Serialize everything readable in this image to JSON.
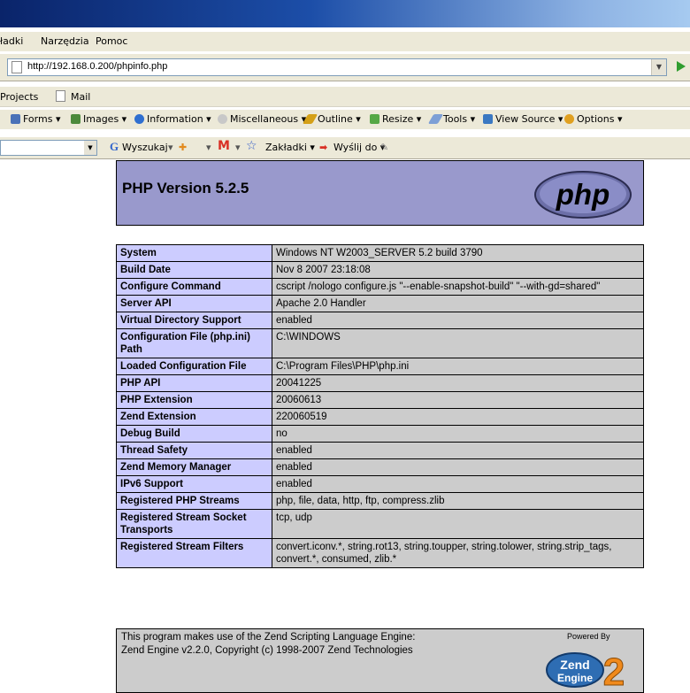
{
  "menu": {
    "items": [
      "ładki",
      "Narzędzia",
      "Pomoc"
    ]
  },
  "address": {
    "url": "http://192.168.0.200/phpinfo.php"
  },
  "links": {
    "items": [
      "Projects",
      "Mail"
    ]
  },
  "devtoolbar": {
    "items": [
      {
        "label": "Forms",
        "icon": "forms-icon",
        "color": "#4a72b8"
      },
      {
        "label": "Images",
        "icon": "images-icon",
        "color": "#4c8a3c"
      },
      {
        "label": "Information",
        "icon": "information-icon",
        "color": "#2f6fd0"
      },
      {
        "label": "Miscellaneous",
        "icon": "miscellaneous-icon",
        "color": "#b8b8b8"
      },
      {
        "label": "Outline",
        "icon": "outline-icon",
        "color": "#d4a017"
      },
      {
        "label": "Resize",
        "icon": "resize-icon",
        "color": "#55a845"
      },
      {
        "label": "Tools",
        "icon": "tools-icon",
        "color": "#7d9fd6"
      },
      {
        "label": "View Source",
        "icon": "view-source-icon",
        "color": "#3a78c2"
      },
      {
        "label": "Options",
        "icon": "options-icon",
        "color": "#e0a020"
      }
    ]
  },
  "googlebar": {
    "search_label": "Wyszukaj",
    "bookmarks_label": "Zakładki",
    "send_label": "Wyślij do"
  },
  "php": {
    "title": "PHP Version 5.2.5",
    "logo_text": "php",
    "rows": [
      {
        "key": "System",
        "value": "Windows NT W2003_SERVER 5.2 build 3790"
      },
      {
        "key": "Build Date",
        "value": "Nov 8 2007 23:18:08"
      },
      {
        "key": "Configure Command",
        "value": "cscript /nologo configure.js \"--enable-snapshot-build\" \"--with-gd=shared\""
      },
      {
        "key": "Server API",
        "value": "Apache 2.0 Handler"
      },
      {
        "key": "Virtual Directory Support",
        "value": "enabled"
      },
      {
        "key": "Configuration File (php.ini) Path",
        "value": "C:\\WINDOWS"
      },
      {
        "key": "Loaded Configuration File",
        "value": "C:\\Program Files\\PHP\\php.ini"
      },
      {
        "key": "PHP API",
        "value": "20041225"
      },
      {
        "key": "PHP Extension",
        "value": "20060613"
      },
      {
        "key": "Zend Extension",
        "value": "220060519"
      },
      {
        "key": "Debug Build",
        "value": "no"
      },
      {
        "key": "Thread Safety",
        "value": "enabled"
      },
      {
        "key": "Zend Memory Manager",
        "value": "enabled"
      },
      {
        "key": "IPv6 Support",
        "value": "enabled"
      },
      {
        "key": "Registered PHP Streams",
        "value": "php, file, data, http, ftp, compress.zlib"
      },
      {
        "key": "Registered Stream Socket Transports",
        "value": "tcp, udp"
      },
      {
        "key": "Registered Stream Filters",
        "value": "convert.iconv.*, string.rot13, string.toupper, string.tolower, string.strip_tags, convert.*, consumed, zlib.*"
      }
    ],
    "footer": {
      "line1": "This program makes use of the Zend Scripting Language Engine:",
      "line2": "Zend Engine v2.2.0, Copyright (c) 1998-2007 Zend Technologies",
      "powered_by": "Powered By",
      "zend_logo_text": "Zend Engine 2"
    }
  }
}
